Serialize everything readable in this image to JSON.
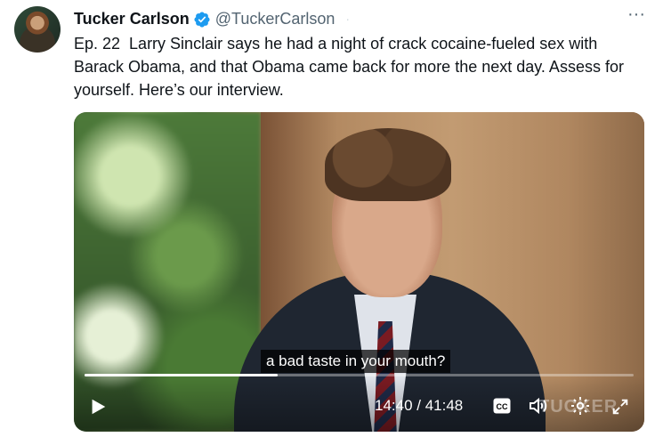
{
  "tweet": {
    "author_name": "Tucker Carlson",
    "handle": "@TuckerCarlson",
    "separator": "·",
    "more_label": "···",
    "text": "Ep. 22  Larry Sinclair says he had a night of crack cocaine-fueled sex with Barack Obama, and that Obama came back for more the next day. Assess for yourself. Here’s our interview."
  },
  "video": {
    "caption": "a bad taste in your mouth?",
    "current_time": "14:40",
    "total_time": "41:48",
    "time_display": "14:40 / 41:48",
    "progress_fraction": 0.351,
    "cc_label": "CC",
    "watermark": "TUCKER"
  },
  "icons": {
    "verified": "verified-badge-icon",
    "more": "more-options-icon",
    "play": "play-icon",
    "cc": "closed-captions-icon",
    "volume": "volume-icon",
    "settings": "gear-icon",
    "fullscreen": "fullscreen-icon"
  },
  "colors": {
    "verified_blue": "#1d9bf0",
    "text_primary": "#0f1419",
    "text_secondary": "#536471"
  }
}
